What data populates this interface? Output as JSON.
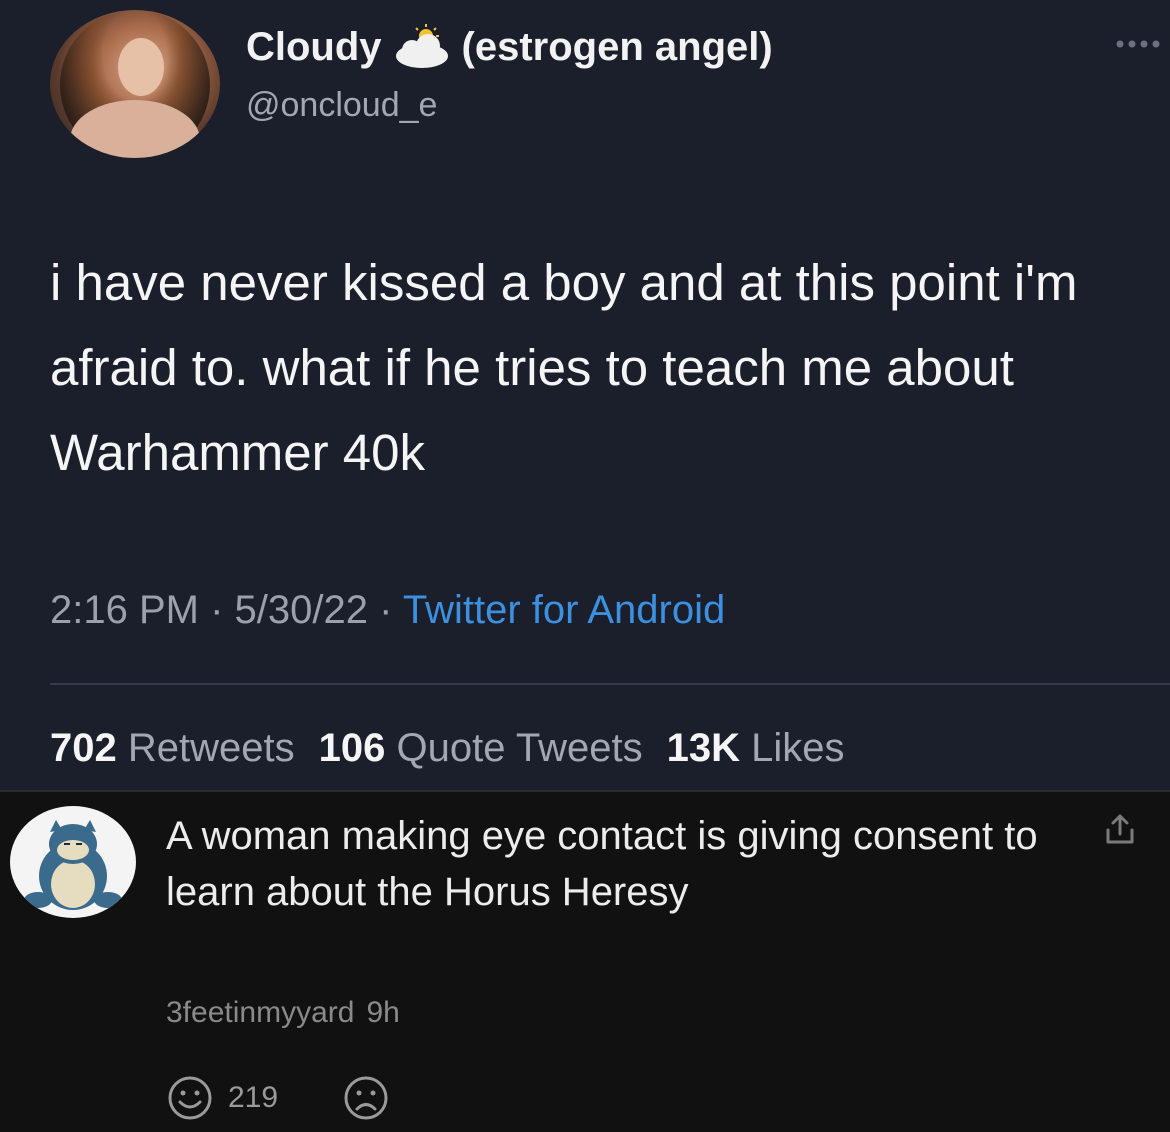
{
  "tweet": {
    "display_name": "Cloudy",
    "name_suffix": "(estrogen angel)",
    "name_emoji_icon": "sun-behind-cloud-icon",
    "handle": "@oncloud_e",
    "text": "i have never kissed a boy and at this point i'm afraid to. what if he tries to teach me about Warhammer 40k",
    "time": "2:16 PM",
    "date": "5/30/22",
    "source": "Twitter for Android",
    "retweets_count": "702",
    "retweets_label": "Retweets",
    "quotes_count": "106",
    "quotes_label": "Quote Tweets",
    "likes_count": "13K",
    "likes_label": "Likes"
  },
  "comment": {
    "text": "A woman making eye contact is giving consent to learn about the Horus Heresy",
    "username": "3feetinmyyard",
    "age": "9h",
    "upvotes": "219",
    "upvote_icon": "smile-icon",
    "downvote_icon": "frown-icon",
    "share_icon": "upload-icon"
  },
  "colors": {
    "tweet_bg": "#1b1e2b",
    "comment_bg": "#111111",
    "link": "#3d8fe0"
  }
}
